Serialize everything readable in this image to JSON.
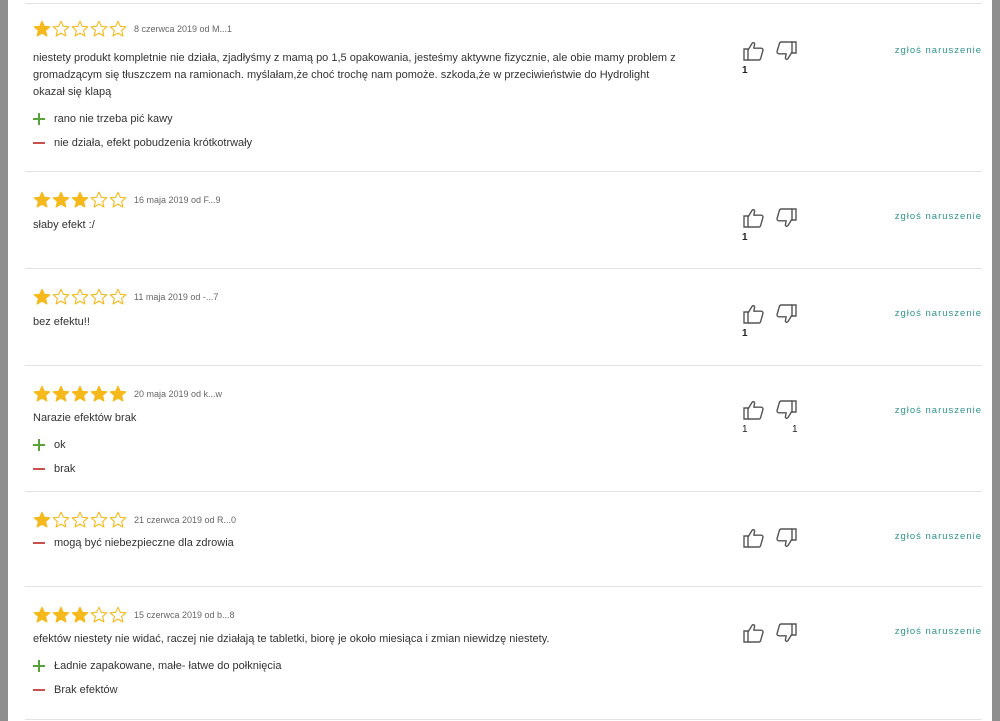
{
  "reviews": [
    {
      "rating": 1,
      "meta": "8 czerwca 2019 od M...1",
      "text": "niestety produkt kompletnie nie działa, zjadłyśmy z mamą po 1,5 opakowania, jesteśmy aktywne fizycznie, ale obie mamy problem z gromadzącym się tłuszczem na ramionach. myślałam,że choć trochę nam pomoże. szkoda,że w przeciwieństwie do Hydrolight okazał się klapą",
      "pros": [
        "rano nie trzeba pić kawy"
      ],
      "cons": [
        "nie działa, efekt pobudzenia krótkotrwały"
      ],
      "likes": "1",
      "dislikes": "",
      "report": "zgłoś naruszenie"
    },
    {
      "rating": 3,
      "meta": "16 maja 2019 od F...9",
      "text": "słaby efekt :/",
      "pros": [],
      "cons": [],
      "likes": "1",
      "dislikes": "",
      "report": "zgłoś naruszenie"
    },
    {
      "rating": 1,
      "meta": "11 maja 2019 od -...7",
      "text": "bez efektu!!",
      "pros": [],
      "cons": [],
      "likes": "1",
      "dislikes": "",
      "report": "zgłoś naruszenie"
    },
    {
      "rating": 5,
      "meta": "20 maja 2019 od k...w",
      "text": "Narazie efektów brak",
      "pros": [
        "ok"
      ],
      "cons": [
        "brak"
      ],
      "likes": "1",
      "dislikes": "1",
      "report": "zgłoś naruszenie"
    },
    {
      "rating": 1,
      "meta": "21 czerwca 2019 od R...0",
      "text": "",
      "pros": [],
      "cons": [
        "mogą być niebezpieczne dla zdrowia"
      ],
      "likes": "",
      "dislikes": "",
      "report": "zgłoś naruszenie"
    },
    {
      "rating": 3,
      "meta": "15 czerwca 2019 od b...8",
      "text": "efektów niestety nie widać, raczej nie działają te tabletki, biorę je około miesiąca i zmian niewidzę niestety.",
      "pros": [
        "Ładnie zapakowane, małe- łatwe do połknięcia"
      ],
      "cons": [
        "Brak efektów"
      ],
      "likes": "",
      "dislikes": "",
      "report": "zgłoś naruszenie"
    }
  ],
  "colors": {
    "star": "#f5b91c",
    "accent": "#2f9389",
    "plus": "#57a33a",
    "minus": "#c9514b"
  },
  "icons": {
    "star": "star-icon",
    "thumb_up": "thumbs-up-icon",
    "thumb_down": "thumbs-down-icon"
  }
}
